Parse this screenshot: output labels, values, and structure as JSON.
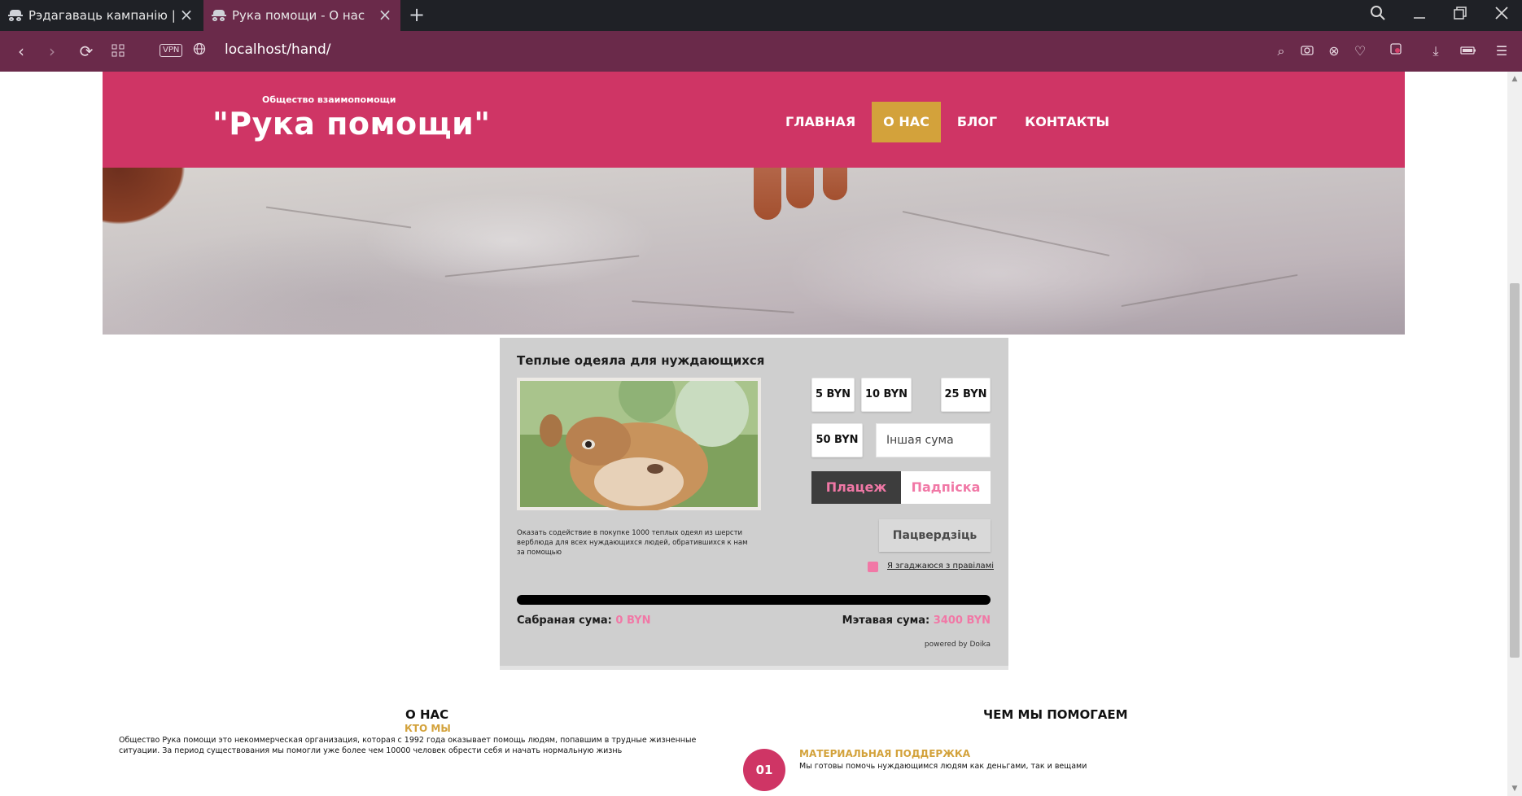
{
  "browser": {
    "tabs": [
      {
        "title": "Рэдагаваць кампанію | Doi",
        "active": false
      },
      {
        "title": "Рука помощи - О нас",
        "active": true
      }
    ],
    "url": "localhost/hand/",
    "vpn_label": "VPN"
  },
  "site": {
    "logo_subtitle": "Общество взаимопомощи",
    "logo_title": "\"Рука помощи\"",
    "menu": [
      {
        "label": "ГЛАВНАЯ",
        "active": false
      },
      {
        "label": "О НАС",
        "active": true
      },
      {
        "label": "БЛОГ",
        "active": false
      },
      {
        "label": "КОНТАКТЫ",
        "active": false
      }
    ]
  },
  "donation": {
    "title": "Теплые одеяла для нуждающихся",
    "description": "Оказать содействие в покупке 1000 теплых одеял из шерсти верблюда для всех нуждающихся людей, обратившихся к нам за помощью",
    "amounts": [
      "5 BYN",
      "10 BYN",
      "25 BYN",
      "50 BYN"
    ],
    "other_amount_placeholder": "Іншая сума",
    "payment_label": "Плацеж",
    "subscription_label": "Падпіска",
    "confirm_label": "Пацвердзіць",
    "agree_label": "Я згаджаюся з правіламі",
    "progress": 0,
    "collected_label": "Сабраная сума:",
    "collected_value": "0 BYN",
    "goal_label": "Мэтавая сума:",
    "goal_value": "3400 BYN",
    "powered_by": "powered by Doika"
  },
  "about": {
    "heading": "О НАС",
    "subheading": "КТО МЫ",
    "text": "Общество Рука помощи это некоммерческая организация, которая с 1992 года оказывает помощь людям, попавшим в трудные жизненные ситуации. За период существования мы помогли уже более чем 10000 человек обрести себя и начать нормальную жизнь"
  },
  "help": {
    "heading": "ЧЕМ МЫ ПОМОГАЕМ",
    "items": [
      {
        "number": "01",
        "title": "МАТЕРИАЛЬНАЯ ПОДДЕРЖКА",
        "text": "Мы готовы помочь нуждающимся людям как деньгами, так и вещами"
      }
    ]
  },
  "colors": {
    "brand_pink": "#cf3565",
    "accent_gold": "#d3a23b",
    "widget_pink": "#f178a6",
    "browser_purple": "#6a2a4a"
  }
}
